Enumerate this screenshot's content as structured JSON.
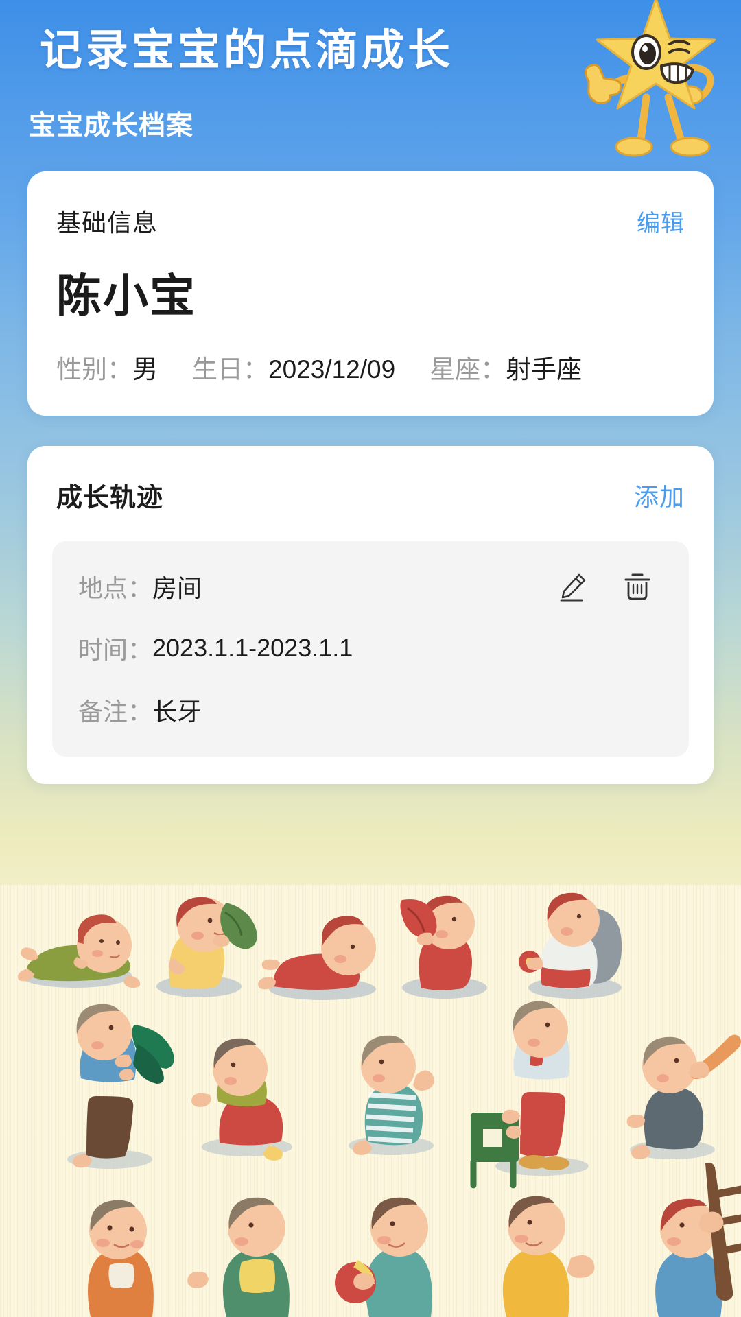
{
  "header": {
    "title": "记录宝宝的点滴成长",
    "subtitle": "宝宝成长档案",
    "mascot_icon": "star-mascot-icon"
  },
  "basic_info_card": {
    "title": "基础信息",
    "edit_label": "编辑",
    "baby_name": "陈小宝",
    "meta": [
      {
        "label": "性别：",
        "value": "男"
      },
      {
        "label": "生日：",
        "value": "2023/12/09"
      },
      {
        "label": "星座：",
        "value": "射手座"
      }
    ]
  },
  "growth_card": {
    "title": "成长轨迹",
    "add_label": "添加",
    "entries": [
      {
        "location_label": "地点：",
        "location_value": "房间",
        "time_label": "时间：",
        "time_value": "2023.1.1-2023.1.1",
        "note_label": "备注：",
        "note_value": "长牙",
        "edit_icon": "pencil-icon",
        "delete_icon": "trash-icon"
      }
    ]
  },
  "illustration": {
    "alt": "watercolor baby illustrations"
  },
  "colors": {
    "header_blue": "#3d8fe8",
    "accent_blue": "#4a9cf0",
    "card_white": "#ffffff",
    "entry_gray": "#f4f4f5",
    "label_gray": "#9a9a9a",
    "text_dark": "#1b1b1b",
    "illustration_cream": "#fbf6dd",
    "mascot_yellow": "#f7d35c"
  }
}
